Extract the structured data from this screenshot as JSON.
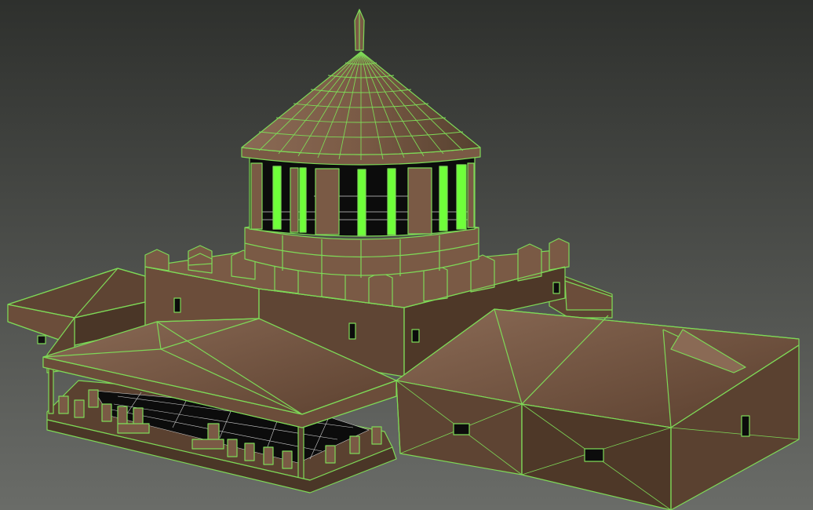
{
  "viewport": {
    "background_top": "#2e302d",
    "background_bottom": "#6a6c68",
    "display_mode": "shaded-with-edged-faces"
  },
  "model": {
    "name": "",
    "colors": {
      "face": "#6b4d3a",
      "face_light": "#8a6a55",
      "face_dark": "#3e2c20",
      "wire": "#7ed957",
      "selected_wire": "#6fff3a",
      "interior": "#0c0c0c"
    },
    "parts": [
      "finial",
      "conical-dome-roof",
      "drum-colonnade",
      "circular-base",
      "crenellated-walls",
      "front-portico-roof",
      "portico-columns",
      "right-wing-roof",
      "left-wing-roof"
    ]
  }
}
